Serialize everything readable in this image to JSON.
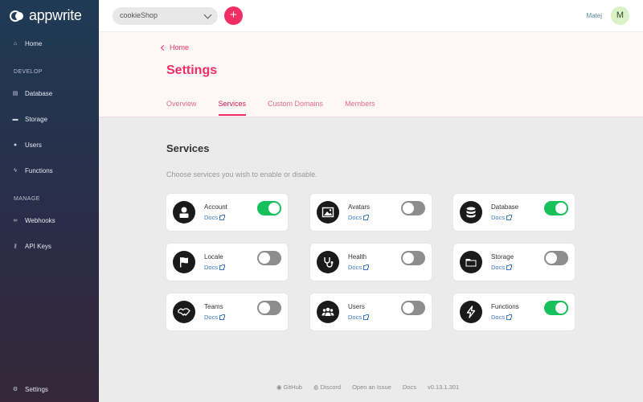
{
  "brand": {
    "name": "appwrite"
  },
  "sidebar": {
    "home": "Home",
    "develop_label": "DEVELOP",
    "develop_items": [
      "Database",
      "Storage",
      "Users",
      "Functions"
    ],
    "manage_label": "MANAGE",
    "manage_items": [
      "Webhooks",
      "API Keys"
    ],
    "settings": "Settings"
  },
  "header": {
    "project": "cookieShop",
    "add_label": "+",
    "user_name": "Matej",
    "avatar_initial": "M"
  },
  "banner": {
    "breadcrumb": "Home",
    "title": "Settings",
    "tabs": [
      "Overview",
      "Services",
      "Custom Domains",
      "Members"
    ],
    "active_tab": "Services"
  },
  "main": {
    "title": "Services",
    "subtitle": "Choose services you wish to enable or disable.",
    "docs_label": "Docs",
    "services": [
      {
        "name": "Account",
        "icon": "account-icon",
        "enabled": true
      },
      {
        "name": "Avatars",
        "icon": "avatars-icon",
        "enabled": false
      },
      {
        "name": "Database",
        "icon": "database-icon",
        "enabled": true
      },
      {
        "name": "Locale",
        "icon": "flag-icon",
        "enabled": false
      },
      {
        "name": "Health",
        "icon": "stethoscope-icon",
        "enabled": false
      },
      {
        "name": "Storage",
        "icon": "folder-icon",
        "enabled": false
      },
      {
        "name": "Teams",
        "icon": "handshake-icon",
        "enabled": false
      },
      {
        "name": "Users",
        "icon": "users-icon",
        "enabled": false
      },
      {
        "name": "Functions",
        "icon": "lightning-icon",
        "enabled": true
      }
    ]
  },
  "footer": {
    "github": "GitHub",
    "discord": "Discord",
    "issue": "Open an Issue",
    "docs": "Docs",
    "version": "v0.13.1.301"
  },
  "colors": {
    "accent": "#f02e65",
    "toggle_on": "#16c05a",
    "toggle_off": "#8d8d8d",
    "link": "#3878c7"
  }
}
